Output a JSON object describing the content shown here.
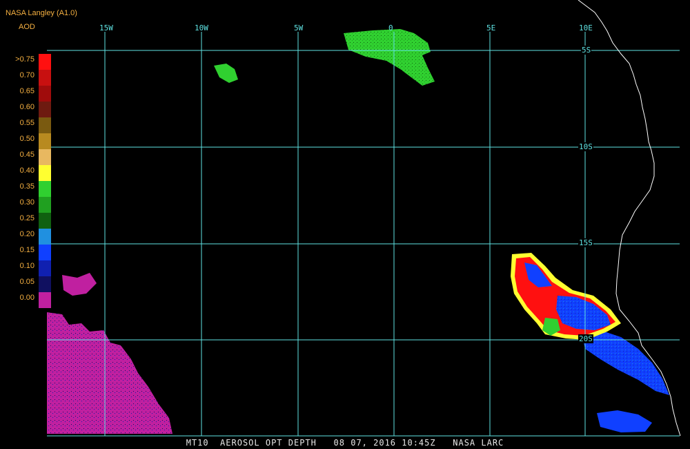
{
  "header": {
    "source": "NASA Langley (A1.0)",
    "product": "AOD"
  },
  "footer": {
    "caption": "MT10  AEROSOL OPT DEPTH   08 07, 2016 10:45Z   NASA LARC"
  },
  "grid": {
    "longitude_labels": [
      "15W",
      "10W",
      "5W",
      "0",
      "5E",
      "10E"
    ],
    "latitude_labels": [
      "5S",
      "10S",
      "15S",
      "20S"
    ],
    "line_color": "#5fe3e3"
  },
  "legend": {
    "entries": [
      {
        "label": ">0.75",
        "color": "#ff1010"
      },
      {
        "label": "0.70",
        "color": "#c81010"
      },
      {
        "label": "0.65",
        "color": "#a00c0c"
      },
      {
        "label": "0.60",
        "color": "#6e1a10"
      },
      {
        "label": "0.55",
        "color": "#7a5a10"
      },
      {
        "label": "0.50",
        "color": "#b88a20"
      },
      {
        "label": "0.45",
        "color": "#e8b860"
      },
      {
        "label": "0.40",
        "color": "#ffff30"
      },
      {
        "label": "0.35",
        "color": "#30d030"
      },
      {
        "label": "0.30",
        "color": "#20a020"
      },
      {
        "label": "0.25",
        "color": "#106010"
      },
      {
        "label": "0.20",
        "color": "#2090e0"
      },
      {
        "label": "0.15",
        "color": "#1040ff"
      },
      {
        "label": "0.10",
        "color": "#1020b0"
      },
      {
        "label": "0.05",
        "color": "#101060"
      },
      {
        "label": "0.00",
        "color": "#c020a0"
      }
    ]
  },
  "colors": {
    "background": "#000000",
    "coastline": "#ffffff",
    "label_text": "#f5b041"
  }
}
